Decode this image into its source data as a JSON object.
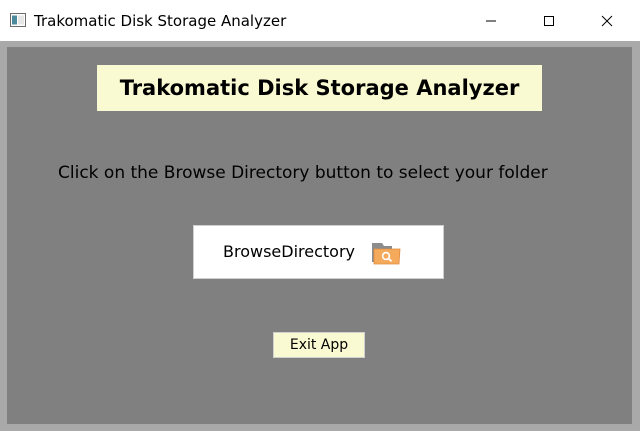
{
  "window": {
    "title": "Trakomatic Disk Storage Analyzer",
    "controls": {
      "minimize_icon": "minimize-icon",
      "maximize_icon": "maximize-icon",
      "close_icon": "close-icon"
    }
  },
  "main": {
    "banner_title": "Trakomatic Disk Storage Analyzer",
    "instruction": "Click on the Browse Directory button to select your folder",
    "browse_button": {
      "label": "BrowseDirectory",
      "icon": "folder-search-icon"
    },
    "exit_button": {
      "label": "Exit App"
    }
  },
  "colors": {
    "client_background": "#808080",
    "frame_background": "#a9a9a9",
    "banner_background": "#fafad2",
    "browse_button_background": "#ffffff",
    "exit_button_background": "#fafad2"
  }
}
